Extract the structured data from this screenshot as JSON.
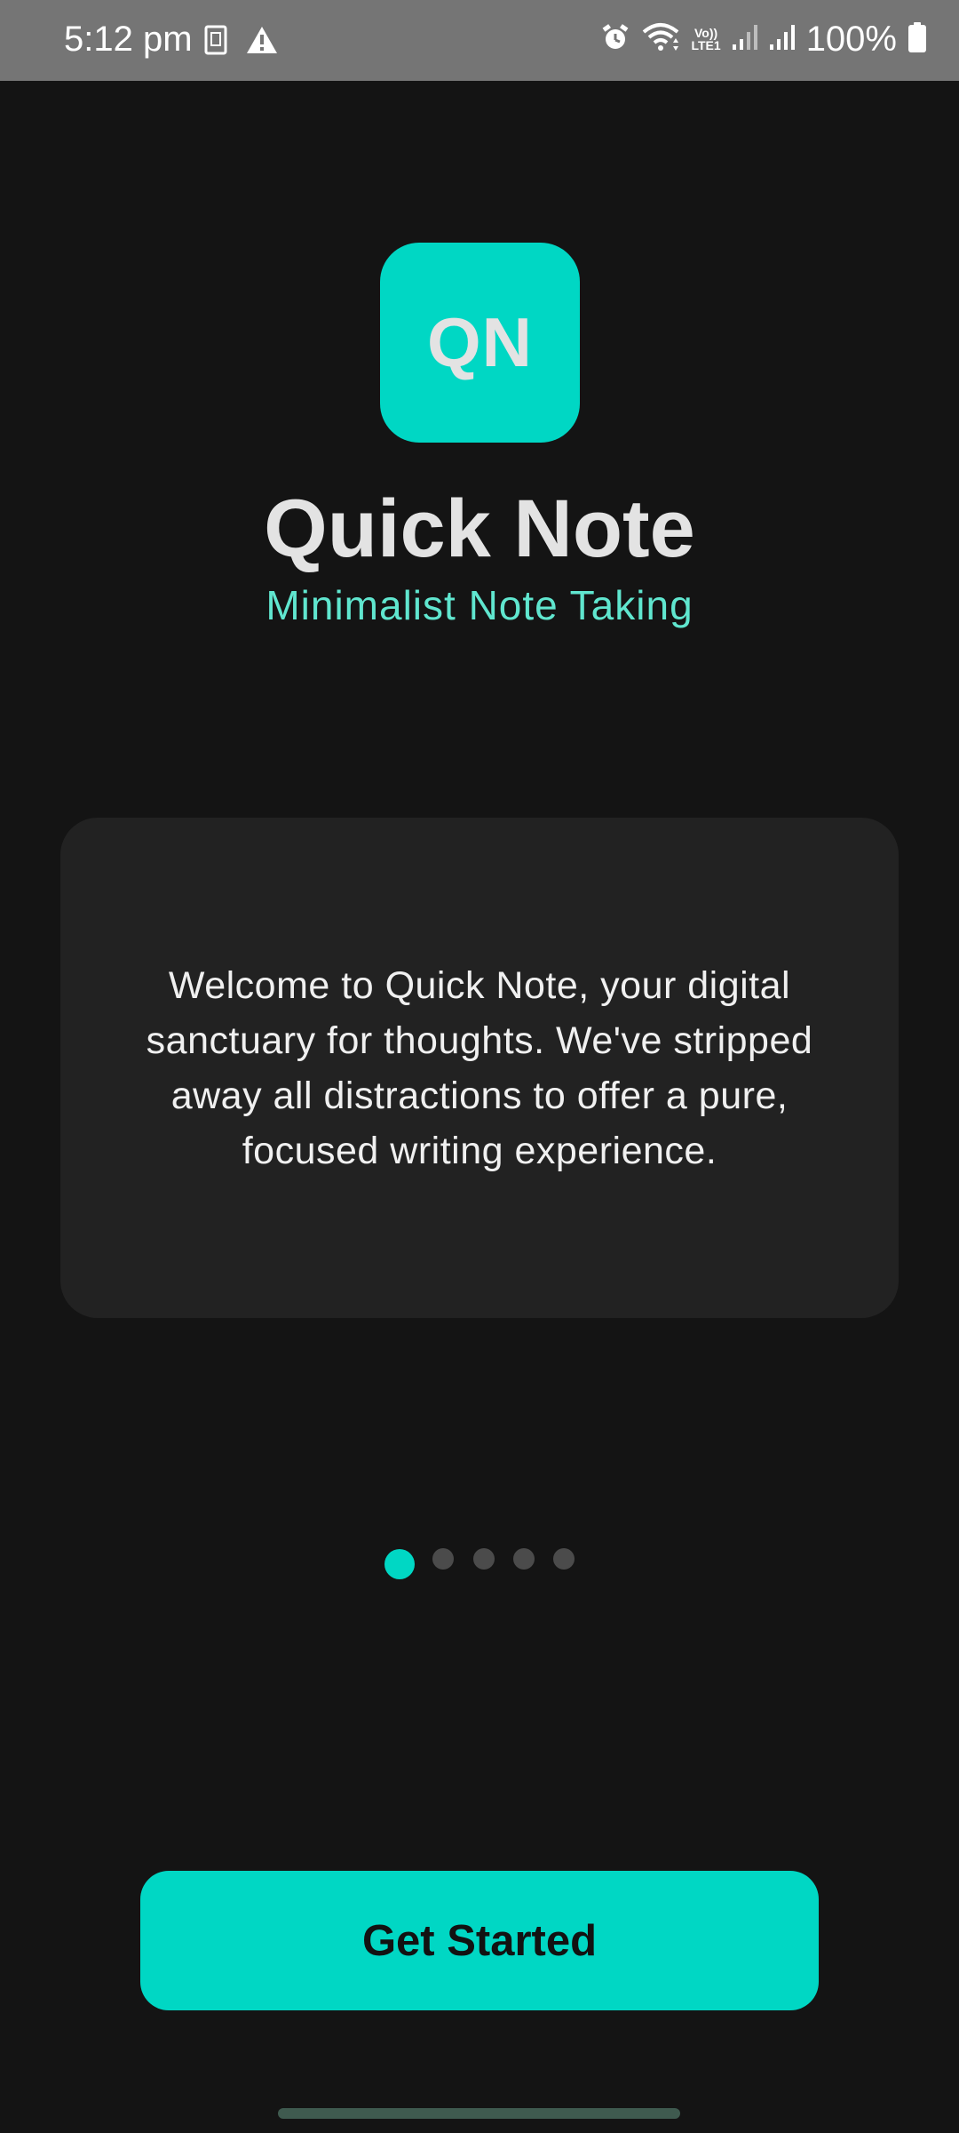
{
  "status_bar": {
    "time": "5:12 pm",
    "battery_percent": "100%",
    "icons": [
      "sim-card-icon",
      "warning-icon",
      "alarm-icon",
      "wifi-icon",
      "volte-icon",
      "signal-icon",
      "signal-icon",
      "battery-icon"
    ],
    "volte_line1": "Vo))",
    "volte_line2": "LTE1"
  },
  "app": {
    "logo_text": "QN",
    "title": "Quick Note",
    "subtitle": "Minimalist Note Taking"
  },
  "welcome_card": {
    "text": "Welcome to Quick Note, your digital sanctuary for thoughts. We've stripped away all distractions to offer a pure, focused writing experience."
  },
  "pager": {
    "total_pages": 5,
    "current_page": 1
  },
  "cta": {
    "label": "Get Started"
  },
  "colors": {
    "accent": "#00d7c4",
    "subtitle": "#60e6cf",
    "background": "#141414",
    "card": "#222222",
    "status_bar": "#757575"
  }
}
